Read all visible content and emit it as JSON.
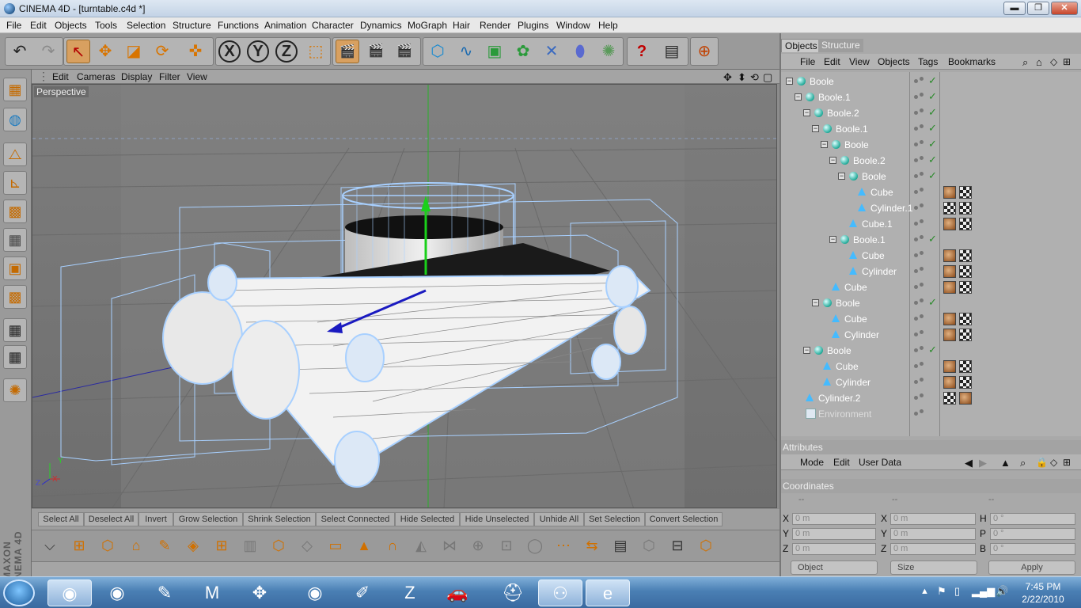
{
  "window": {
    "title": "CINEMA 4D - [turntable.c4d *]",
    "minimize": "▬",
    "maximize": "❐",
    "close": "✕"
  },
  "menubar": [
    "File",
    "Edit",
    "Objects",
    "Tools",
    "Selection",
    "Structure",
    "Functions",
    "Animation",
    "Character",
    "Dynamics",
    "MoGraph",
    "Hair",
    "Render",
    "Plugins",
    "Window",
    "Help"
  ],
  "toolbar_icons": [
    "undo-icon",
    "redo-icon",
    "select-icon",
    "move-icon",
    "scale-icon",
    "rotate-icon",
    "move-live-icon",
    "x-axis-icon",
    "y-axis-icon",
    "z-axis-icon",
    "coordinate-system-icon",
    "render-view-icon",
    "render-picture-icon",
    "render-settings-icon",
    "cube-primitive-icon",
    "spline-icon",
    "nurbs-icon",
    "array-icon",
    "deformer-icon",
    "scene-icon",
    "environment-icon",
    "help-icon",
    "layer-manager-icon",
    "web-icon"
  ],
  "toolbar_glyphs": {
    "undo": "↶",
    "redo": "↷",
    "select": "↖",
    "move": "✥",
    "scale": "◪",
    "rotate": "⟳",
    "live": "✜",
    "x": "X",
    "y": "Y",
    "z": "Z",
    "coord": "⬚",
    "r1": "🎬",
    "r2": "🎬",
    "r3": "🎬",
    "cube": "⬡",
    "spline": "∿",
    "nurbs": "▣",
    "array": "✿",
    "deform": "✕",
    "scene": "⬮",
    "env": "✺",
    "help": "?",
    "layer": "▤",
    "web": "⊕"
  },
  "left_palette_glyphs": [
    "▦",
    "◍",
    "⧍",
    "⊾",
    "▩",
    "▦",
    "▣",
    "▩",
    "▦",
    "▦",
    "▧",
    "✺"
  ],
  "maxon_logo": "MAXON CINEMA 4D",
  "viewport": {
    "menu": [
      "Edit",
      "Cameras",
      "Display",
      "Filter",
      "View"
    ],
    "label": "Perspective",
    "nav_icons": [
      "move-view-icon",
      "zoom-view-icon",
      "rotate-view-icon",
      "maximize-view-icon"
    ],
    "nav_glyphs": [
      "✥",
      "⬍",
      "⟲",
      "▢"
    ],
    "axis_labels": {
      "x": "X",
      "y": "Y",
      "z": "Z"
    }
  },
  "selection_row": [
    "Select All",
    "Deselect All",
    "Invert",
    "Grow Selection",
    "Shrink Selection",
    "Select Connected",
    "Hide Selected",
    "Hide Unselected",
    "Unhide All",
    "Set Selection",
    "Convert Selection"
  ],
  "tools2_glyphs": [
    "⌵",
    "⊞",
    "⬡",
    "⌂",
    "✎",
    "◈",
    "⊞",
    "▥",
    "⬡",
    "◇",
    "▭",
    "▲",
    "∩",
    "◭",
    "⋈",
    "⊕",
    "⊡",
    "◯",
    "⋯",
    "⇆",
    "▤",
    "⬡",
    "⊟",
    "⬡"
  ],
  "panel_tabs": {
    "objects": "Objects",
    "structure": "Structure"
  },
  "object_menu": [
    "File",
    "Edit",
    "View",
    "Objects",
    "Tags",
    "Bookmarks"
  ],
  "objects": [
    {
      "name": "Boole",
      "type": "boole",
      "depth": 0,
      "tags": []
    },
    {
      "name": "Boole.1",
      "type": "boole",
      "depth": 1,
      "tags": []
    },
    {
      "name": "Boole.2",
      "type": "boole",
      "depth": 2,
      "tags": []
    },
    {
      "name": "Boole.1",
      "type": "boole",
      "depth": 3,
      "tags": []
    },
    {
      "name": "Boole",
      "type": "boole",
      "depth": 4,
      "tags": []
    },
    {
      "name": "Boole.2",
      "type": "boole",
      "depth": 5,
      "tags": []
    },
    {
      "name": "Boole",
      "type": "boole",
      "depth": 6,
      "tags": []
    },
    {
      "name": "Cube",
      "type": "prim",
      "depth": 7,
      "tags": [
        "mat",
        "chk"
      ]
    },
    {
      "name": "Cylinder.1",
      "type": "prim",
      "depth": 7,
      "tags": [
        "chk",
        "chk"
      ]
    },
    {
      "name": "Cube.1",
      "type": "prim",
      "depth": 6,
      "tags": [
        "mat",
        "chk"
      ]
    },
    {
      "name": "Boole.1",
      "type": "boole",
      "depth": 5,
      "tags": []
    },
    {
      "name": "Cube",
      "type": "prim",
      "depth": 6,
      "tags": [
        "mat",
        "chk"
      ]
    },
    {
      "name": "Cylinder",
      "type": "prim",
      "depth": 6,
      "tags": [
        "mat",
        "chk"
      ]
    },
    {
      "name": "Cube",
      "type": "prim",
      "depth": 4,
      "tags": [
        "mat",
        "chk"
      ]
    },
    {
      "name": "Boole",
      "type": "boole",
      "depth": 3,
      "tags": []
    },
    {
      "name": "Cube",
      "type": "prim",
      "depth": 4,
      "tags": [
        "mat",
        "chk"
      ]
    },
    {
      "name": "Cylinder",
      "type": "prim",
      "depth": 4,
      "tags": [
        "mat",
        "chk"
      ]
    },
    {
      "name": "Boole",
      "type": "boole",
      "depth": 2,
      "tags": []
    },
    {
      "name": "Cube",
      "type": "prim",
      "depth": 3,
      "tags": [
        "mat",
        "chk"
      ]
    },
    {
      "name": "Cylinder",
      "type": "prim",
      "depth": 3,
      "tags": [
        "mat",
        "chk"
      ]
    },
    {
      "name": "Cylinder.2",
      "type": "prim",
      "depth": 1,
      "tags": [
        "chk",
        "mat"
      ]
    },
    {
      "name": "Environment",
      "type": "env",
      "depth": 1,
      "tags": []
    }
  ],
  "check_glyph": "✓",
  "attributes": {
    "header": "Attributes",
    "menu": [
      "Mode",
      "Edit",
      "User Data"
    ]
  },
  "coordinates": {
    "header": "Coordinates",
    "col_headers": [
      "--",
      "--",
      "--"
    ],
    "rows": [
      {
        "a": "X",
        "av": "0 m",
        "b": "X",
        "bv": "0 m",
        "c": "H",
        "cv": "0 °"
      },
      {
        "a": "Y",
        "av": "0 m",
        "b": "Y",
        "bv": "0 m",
        "c": "P",
        "cv": "0 °"
      },
      {
        "a": "Z",
        "av": "0 m",
        "b": "Z",
        "bv": "0 m",
        "c": "B",
        "cv": "0 °"
      }
    ],
    "object_mode": "Object",
    "size_mode": "Size",
    "apply": "Apply"
  },
  "taskbar": {
    "apps": [
      "start-orb",
      "cinema4d-app",
      "cinema4d-app-2",
      "zbrush-app",
      "maxon-app",
      "mocha-app",
      "blender-app",
      "sketch-app",
      "zip-app",
      "car-app",
      "construction-app",
      "network-app",
      "ie-browser"
    ],
    "glyphs": [
      "◉",
      "◉",
      "✎",
      "M",
      "✥",
      "◉",
      "✐",
      "Z",
      "🚗",
      "⛑",
      "⚇",
      "e"
    ],
    "time": "7:45 PM",
    "date": "2/22/2010"
  }
}
